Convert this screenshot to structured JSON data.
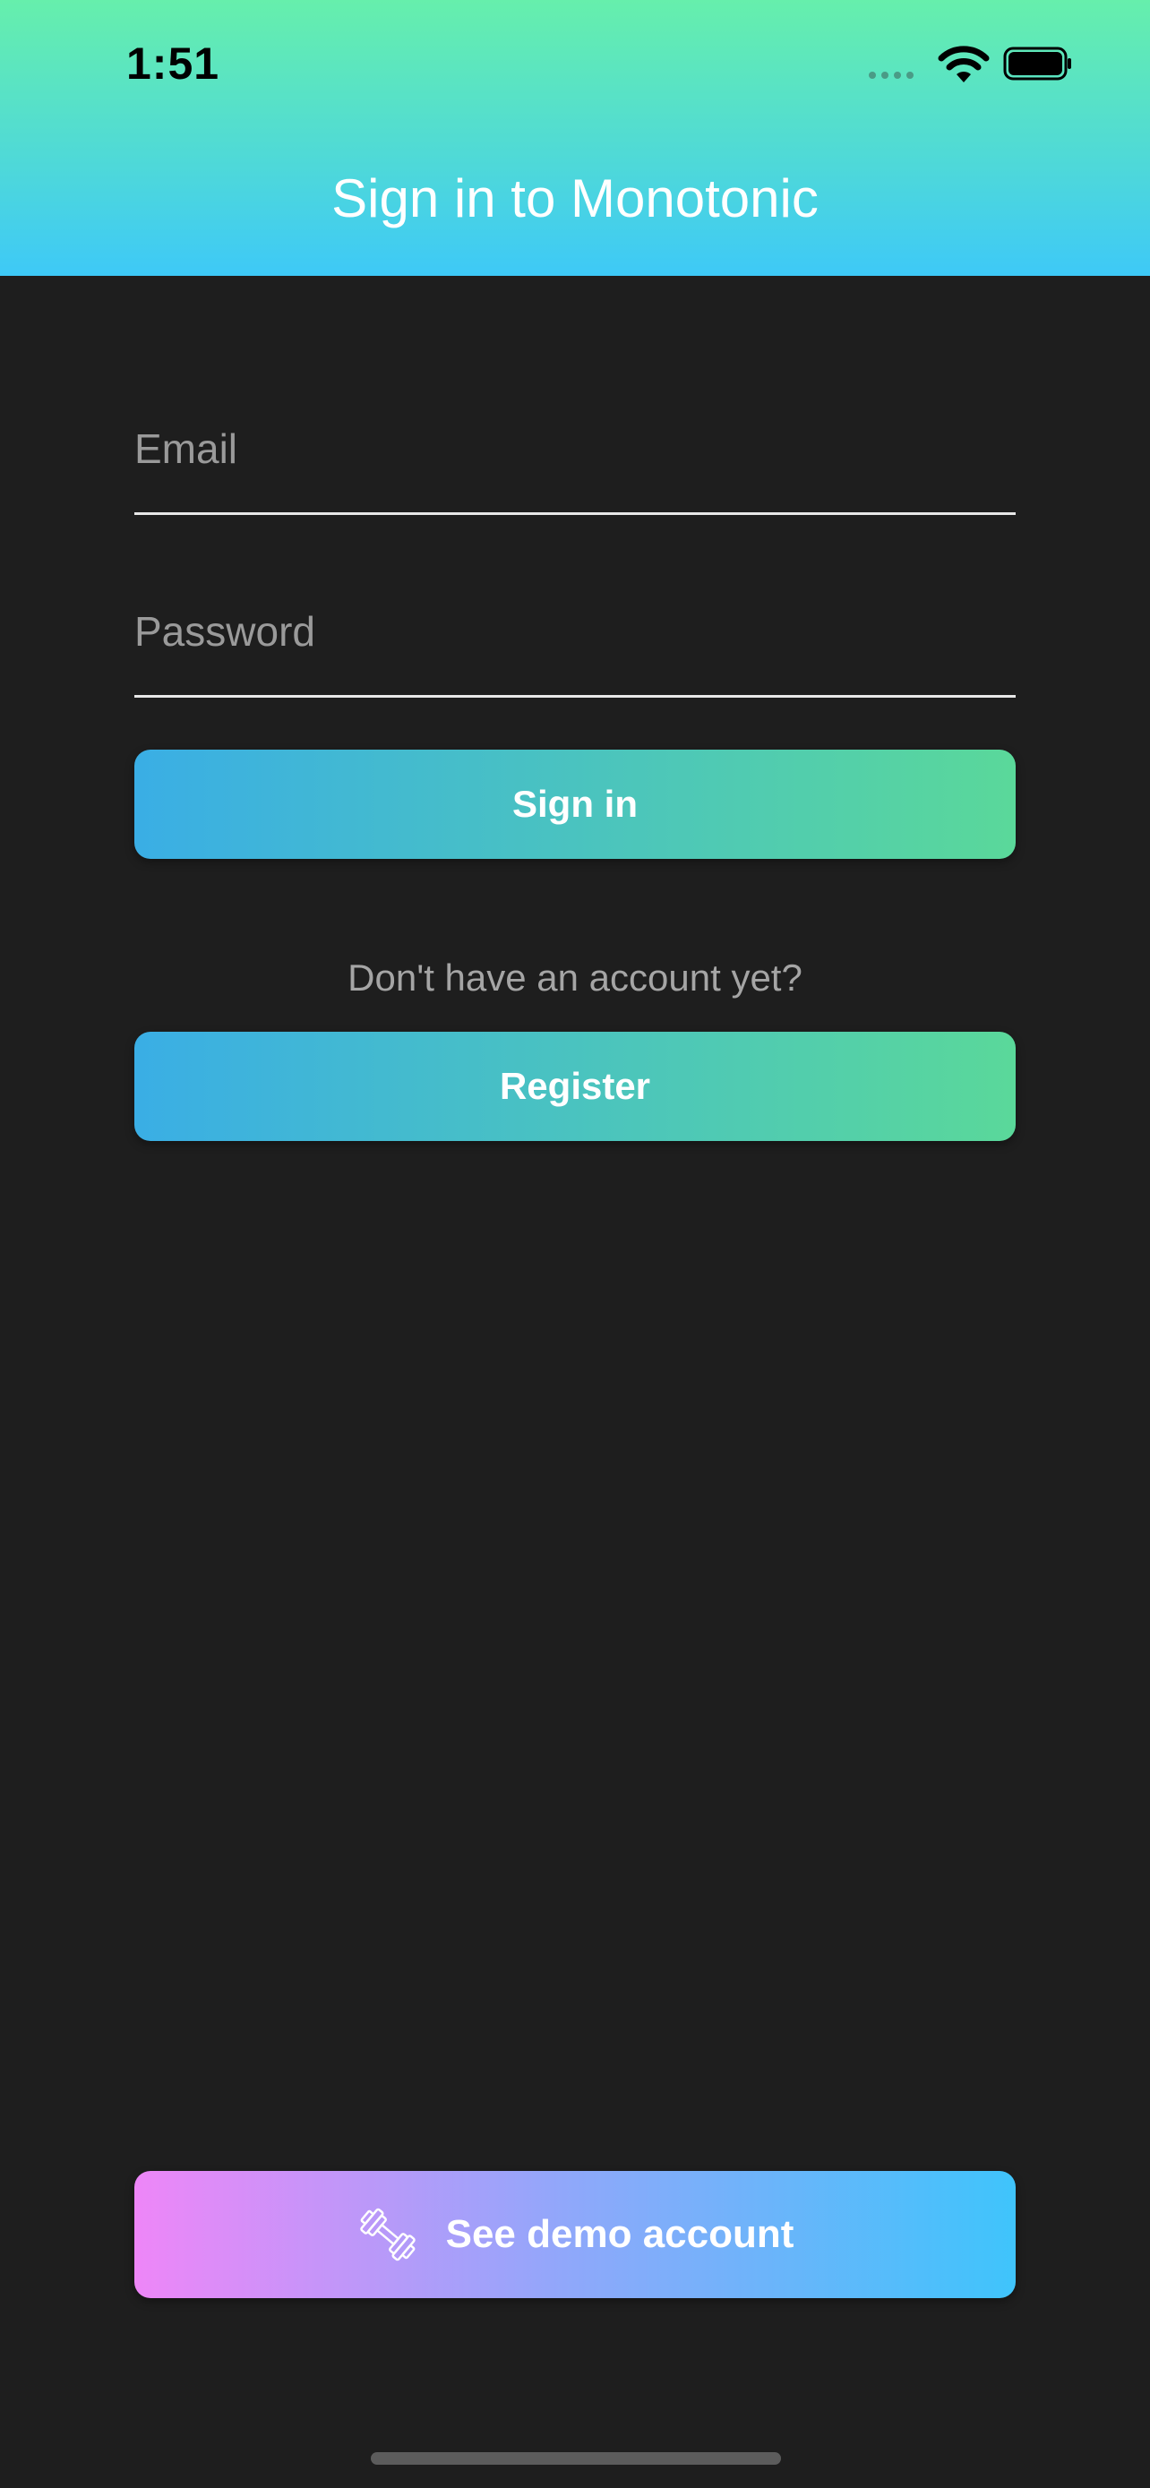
{
  "status_bar": {
    "time": "1:51",
    "icons": [
      "cellular-signal-icon",
      "wifi-icon",
      "battery-icon"
    ]
  },
  "header": {
    "title": "Sign in to Monotonic",
    "gradient": [
      "#66efac",
      "#3ec9f7"
    ]
  },
  "form": {
    "email_placeholder": "Email",
    "email_value": "",
    "password_placeholder": "Password",
    "password_value": "",
    "signin_label": "Sign in",
    "register_prompt": "Don't have an account yet?",
    "register_label": "Register"
  },
  "demo": {
    "label": "See demo account",
    "icon": "dumbbell-icon"
  },
  "colors": {
    "background": "#1e1e1e",
    "button_gradient": [
      "#3aaee5",
      "#5ad89a"
    ],
    "demo_gradient": [
      "#ee86f8",
      "#3fc4fb"
    ]
  }
}
